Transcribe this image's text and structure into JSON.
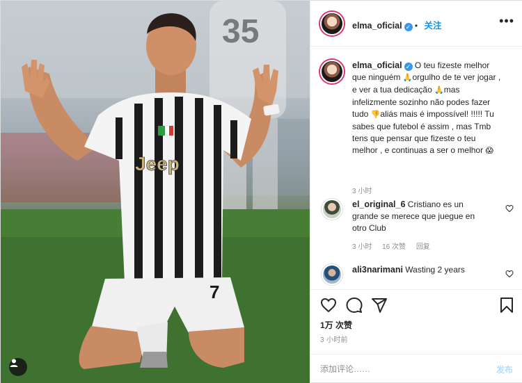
{
  "post": {
    "author": "elma_oficial",
    "follow_label": "关注",
    "more_icon": "more-horizontal-icon",
    "caption": {
      "author": "elma_oficial",
      "part1": "O teu fizeste melhor que ninguém",
      "emoji1": "🙏",
      "part2": "orgulho de te ver jogar , e ver a tua dedicação",
      "emoji2": "🙏",
      "part3": "mas infelizmente sozinho não podes fazer tudo",
      "emoji3": "👎",
      "part4": "aliás mais é impossível! !!!!! Tu sabes que futebol é assim , mas Tmb tens que pensar que fizeste o teu melhor , e continuas a ser o melhor",
      "emoji4": "😱",
      "time": "3 小时"
    },
    "comments": [
      {
        "user": "el_original_6",
        "text": "Cristiano es un grande se merece que juegue en otro Club",
        "time": "3 小时",
        "likes": "16 次赞",
        "reply": "回复"
      },
      {
        "user": "ali3narimani",
        "text": "Wasting 2 years",
        "time": "",
        "likes": "",
        "reply": ""
      }
    ],
    "likes": "1万 次赞",
    "time_ago": "3 小时前",
    "add_comment_placeholder": "添加评论……",
    "post_button": "发布"
  },
  "photo": {
    "jersey_text": "Jeep",
    "number": "7",
    "background_number": "35"
  },
  "colors": {
    "verified": "#3897f0",
    "follow": "#0095f6",
    "post_disabled": "#b2dffc"
  }
}
